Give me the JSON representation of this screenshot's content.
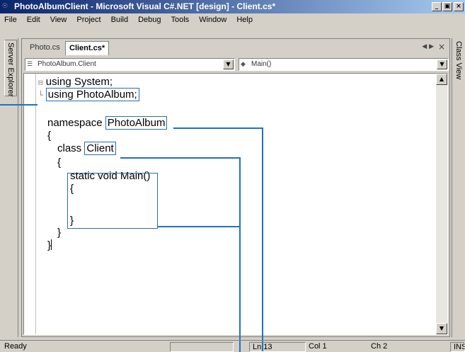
{
  "window": {
    "title": "PhotoAlbumClient - Microsoft Visual C#.NET [design] - Client.cs*",
    "icon": "devenv-icon",
    "controls": {
      "minimize": "_",
      "maximize": "×",
      "close": "×"
    }
  },
  "menu": [
    "File",
    "Edit",
    "View",
    "Project",
    "Build",
    "Debug",
    "Tools",
    "Window",
    "Help"
  ],
  "side_tabs": {
    "left": "Server Explorer",
    "right": "Class View"
  },
  "doc_tabs": [
    {
      "label": "Photo.cs",
      "active": false
    },
    {
      "label": "Client.cs*",
      "active": true
    }
  ],
  "tab_nav": "◀ ▶",
  "tab_close": "×",
  "type_combo": {
    "icon": "class-icon",
    "value": "PhotoAlbum.Client"
  },
  "member_combo": {
    "icon": "method-icon",
    "value": "Main()"
  },
  "code": {
    "l1_mark": "⊟",
    "l1": "using System;",
    "l2_mark": "└",
    "l2": "using PhotoAlbum;",
    "l3_kw": "namespace",
    "l3_name": "PhotoAlbum",
    "l4": "{",
    "l5_kw": "class",
    "l5_name": "Client",
    "l6": "{",
    "l7": "static void Main()",
    "l8": "{",
    "l9": "}",
    "l10": "}",
    "l11": "}"
  },
  "status": {
    "ready": "Ready",
    "line": "Ln 13",
    "col": "Col 1",
    "ch": "Ch 2",
    "mode": "INS"
  },
  "colors": {
    "callout": "#1f73b8",
    "title_start": "#0a246a",
    "title_end": "#a6caf0",
    "chrome": "#d4d0c8"
  }
}
